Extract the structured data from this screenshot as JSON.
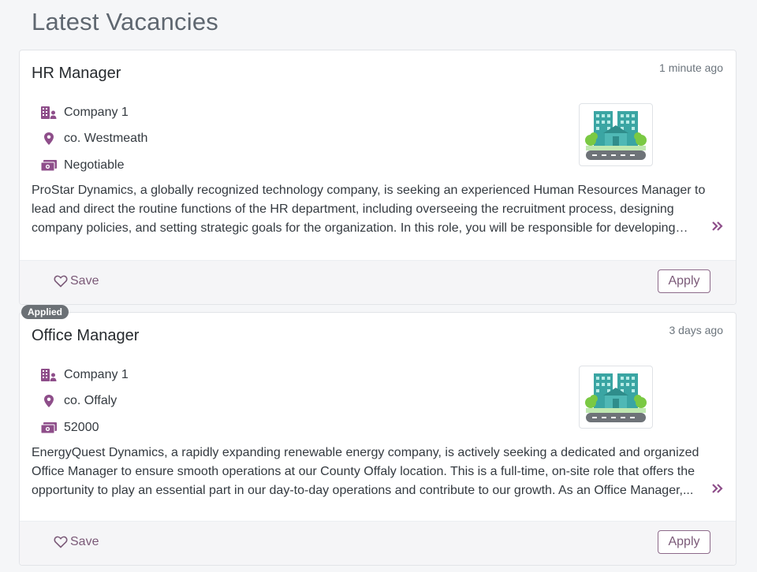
{
  "page": {
    "title": "Latest Vacancies"
  },
  "colors": {
    "accent": "#7b5a78",
    "icon": "#8e4e8a",
    "badge": "#6b7075"
  },
  "jobs": [
    {
      "title": "HR Manager",
      "time": "1 minute ago",
      "company": "Company 1",
      "location": "co. Westmeath",
      "salary": "Negotiable",
      "description": "ProStar Dynamics, a globally recognized technology company, is seeking an experienced Human Resources Manager to lead and direct the routine functions of the HR department, including overseeing the recruitment process, designing company policies, and setting strategic goals for the organization. In this role, you will be responsible for developing and...",
      "save_label": "Save",
      "apply_label": "Apply",
      "applied": false
    },
    {
      "title": "Office Manager",
      "time": "3 days ago",
      "company": "Company 1",
      "location": "co. Offaly",
      "salary": "52000",
      "description": "EnergyQuest Dynamics, a rapidly expanding renewable energy company, is actively seeking a dedicated and organized Office Manager to ensure smooth operations at our County Offaly location. This is a full-time, on-site role that offers the opportunity to play an essential part in our day-to-day operations and contribute to our growth. As an Office Manager,...",
      "save_label": "Save",
      "apply_label": "Apply",
      "applied": true,
      "applied_label": "Applied"
    }
  ]
}
